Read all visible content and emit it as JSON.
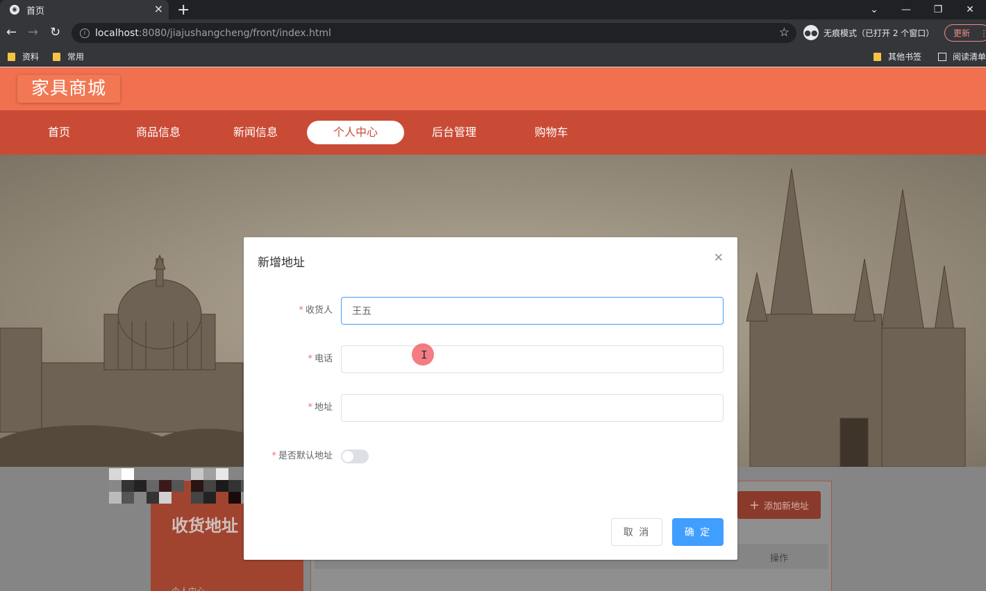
{
  "browser": {
    "tab_title": "首页",
    "url_host": "localhost",
    "url_rest": ":8080/jiajushangcheng/front/index.html",
    "incognito_text": "无痕模式（已打开 2 个窗口）",
    "update_label": "更新",
    "bookmarks": [
      {
        "label": "资料"
      },
      {
        "label": "常用"
      }
    ],
    "other_bookmarks": "其他书签",
    "reading_list": "阅读清单"
  },
  "site": {
    "logo": "家具商城",
    "nav": [
      {
        "label": "首页"
      },
      {
        "label": "商品信息"
      },
      {
        "label": "新闻信息"
      },
      {
        "label": "个人中心",
        "active": true
      },
      {
        "label": "后台管理"
      },
      {
        "label": "购物车"
      }
    ],
    "side_title": "收货地址",
    "side_sub": "个人中心",
    "add_address_label": "添加新地址",
    "table_op_header": "操作"
  },
  "dialog": {
    "title": "新增地址",
    "fields": {
      "receiver_label": "收货人",
      "receiver_value": "王五",
      "phone_label": "电话",
      "phone_value": "",
      "address_label": "地址",
      "address_value": "",
      "default_label": "是否默认地址",
      "default_on": false
    },
    "cancel_label": "取 消",
    "ok_label": "确 定"
  },
  "colors": {
    "brand": "#f07050",
    "nav": "#c94b36",
    "primary": "#409eff",
    "required": "#f56c6c"
  }
}
